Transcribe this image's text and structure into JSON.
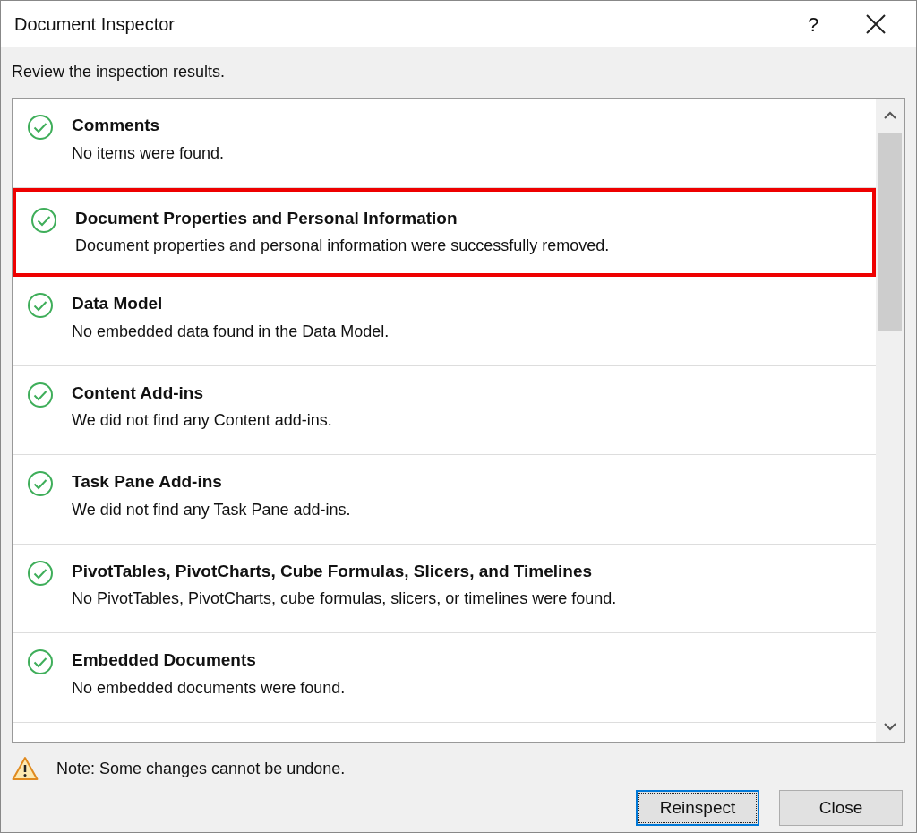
{
  "window": {
    "title": "Document Inspector",
    "help": "?"
  },
  "instruction": "Review the inspection results.",
  "items": [
    {
      "title": "Comments",
      "description": "No items were found.",
      "kind": "passed",
      "highlighted": false
    },
    {
      "title": "Document Properties and Personal Information",
      "description": "Document properties and personal information were successfully removed.",
      "kind": "passed",
      "highlighted": true
    },
    {
      "title": "Data Model",
      "description": "No embedded data found in the Data Model.",
      "kind": "passed",
      "highlighted": false
    },
    {
      "title": "Content Add-ins",
      "description": "We did not find any Content add-ins.",
      "kind": "passed",
      "highlighted": false
    },
    {
      "title": "Task Pane Add-ins",
      "description": "We did not find any Task Pane add-ins.",
      "kind": "passed",
      "highlighted": false
    },
    {
      "title": "PivotTables, PivotCharts, Cube Formulas, Slicers, and Timelines",
      "description": "No PivotTables, PivotCharts, cube formulas, slicers, or timelines were found.",
      "kind": "passed",
      "highlighted": false
    },
    {
      "title": "Embedded Documents",
      "description": "No embedded documents were found.",
      "kind": "passed",
      "highlighted": false
    }
  ],
  "note": "Note: Some changes cannot be undone.",
  "buttons": [
    {
      "label": "Reinspect",
      "focused": true
    },
    {
      "label": "Close",
      "focused": false
    }
  ]
}
